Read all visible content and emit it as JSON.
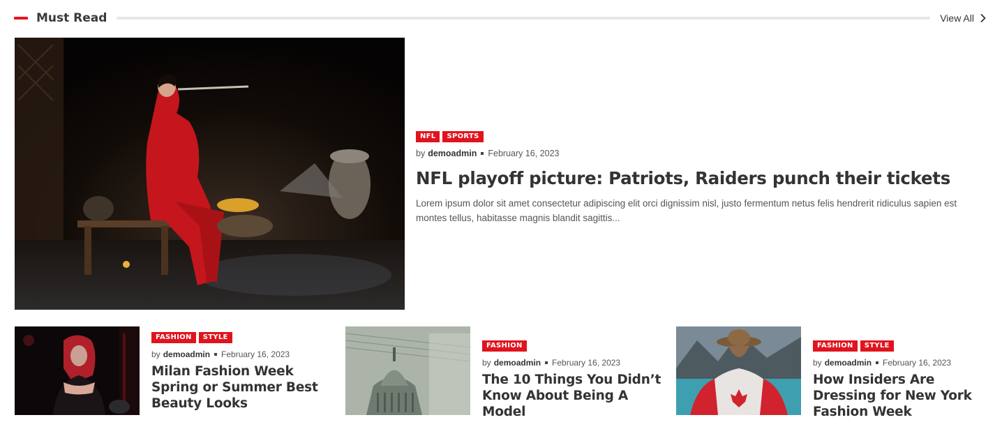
{
  "section": {
    "title": "Must Read",
    "view_all_label": "View All"
  },
  "featured": {
    "tags": [
      "NFL",
      "SPORTS"
    ],
    "by": "by",
    "author": "demoadmin",
    "date": "February 16, 2023",
    "title": "NFL playoff picture: Patriots, Raiders punch their tickets",
    "excerpt": "Lorem ipsum dolor sit amet consectetur adipiscing elit orci dignissim nisl, justo fermentum netus felis hendrerit ridiculus sapien est montes tellus, habitasse magnis blandit sagittis..."
  },
  "cards": [
    {
      "tags": [
        "FASHION",
        "STYLE"
      ],
      "by": "by",
      "author": "demoadmin",
      "date": "February 16, 2023",
      "title": "Milan Fashion Week Spring or Summer Best Beauty Looks"
    },
    {
      "tags": [
        "FASHION"
      ],
      "by": "by",
      "author": "demoadmin",
      "date": "February 16, 2023",
      "title": "The 10 Things You Didn’t Know About Being A Model"
    },
    {
      "tags": [
        "FASHION",
        "STYLE"
      ],
      "by": "by",
      "author": "demoadmin",
      "date": "February 16, 2023",
      "title": "How Insiders Are Dressing for New York Fashion Week"
    }
  ],
  "colors": {
    "accent": "#e0141e",
    "heading": "#333333",
    "divider": "#e6e6e6"
  }
}
